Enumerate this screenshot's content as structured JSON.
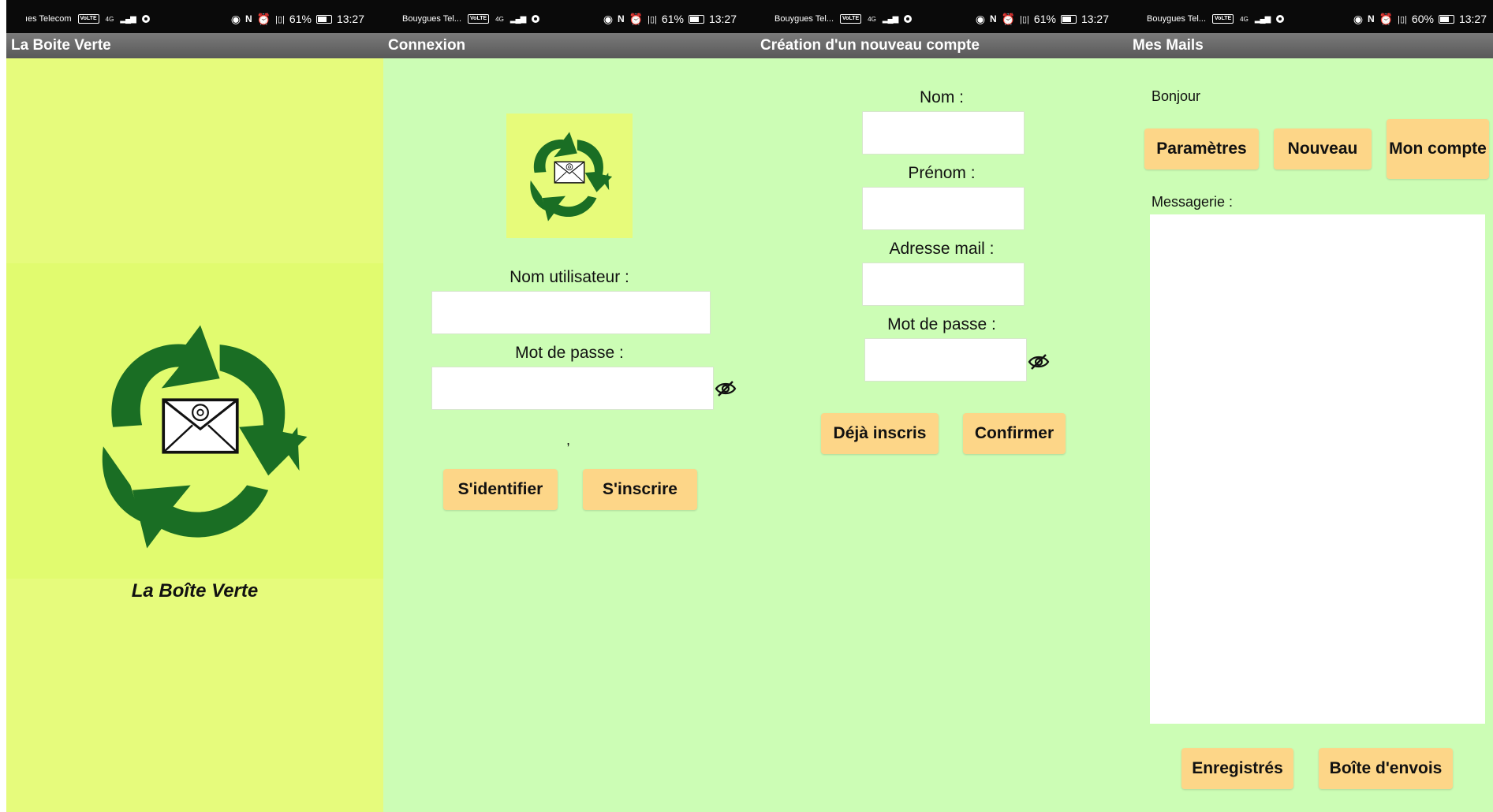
{
  "screens": [
    {
      "status": {
        "carrier": "ıes Telecom",
        "network": "4G",
        "battery_pct": "61%",
        "battery_level": 0.61,
        "time": "13:27"
      },
      "title": "La Boite Verte",
      "brand_text": "La Boîte Verte",
      "background": "#e6fb7c"
    },
    {
      "status": {
        "carrier": "Bouygues Tel...",
        "network": "4G",
        "battery_pct": "61%",
        "battery_level": 0.61,
        "time": "13:27"
      },
      "title": "Connexion",
      "username_label": "Nom utilisateur :",
      "username_value": "",
      "password_label": "Mot de passe :",
      "password_value": "",
      "message_text": ",",
      "login_button": "S'identifier",
      "signup_button": "S'inscrire",
      "background": "#ccfdb5"
    },
    {
      "status": {
        "carrier": "Bouygues Tel...",
        "network": "4G",
        "battery_pct": "61%",
        "battery_level": 0.61,
        "time": "13:27"
      },
      "title": "Création d'un nouveau compte",
      "nom_label": "Nom :",
      "prenom_label": "Prénom :",
      "email_label": "Adresse mail :",
      "password_label": "Mot de passe :",
      "already_button": "Déjà inscris",
      "confirm_button": "Confirmer",
      "background": "#ccfdb5"
    },
    {
      "status": {
        "carrier": "Bouygues Tel...",
        "network": "4G",
        "battery_pct": "60%",
        "battery_level": 0.6,
        "time": "13:27"
      },
      "title": "Mes Mails",
      "greeting": "Bonjour",
      "settings_button": "Paramètres",
      "new_button": "Nouveau",
      "account_button": "Mon compte",
      "inbox_label": "Messagerie :",
      "saved_button": "Enregistrés",
      "outbox_button": "Boîte d'envois",
      "background": "#ccfdb5"
    }
  ],
  "colors": {
    "button": "#fdd688",
    "appbar": "#6b6b6b",
    "logo_green": "#1a6e24"
  },
  "icons": {
    "logo": "recycle-envelope-icon",
    "eye": "eye-slash-icon"
  }
}
